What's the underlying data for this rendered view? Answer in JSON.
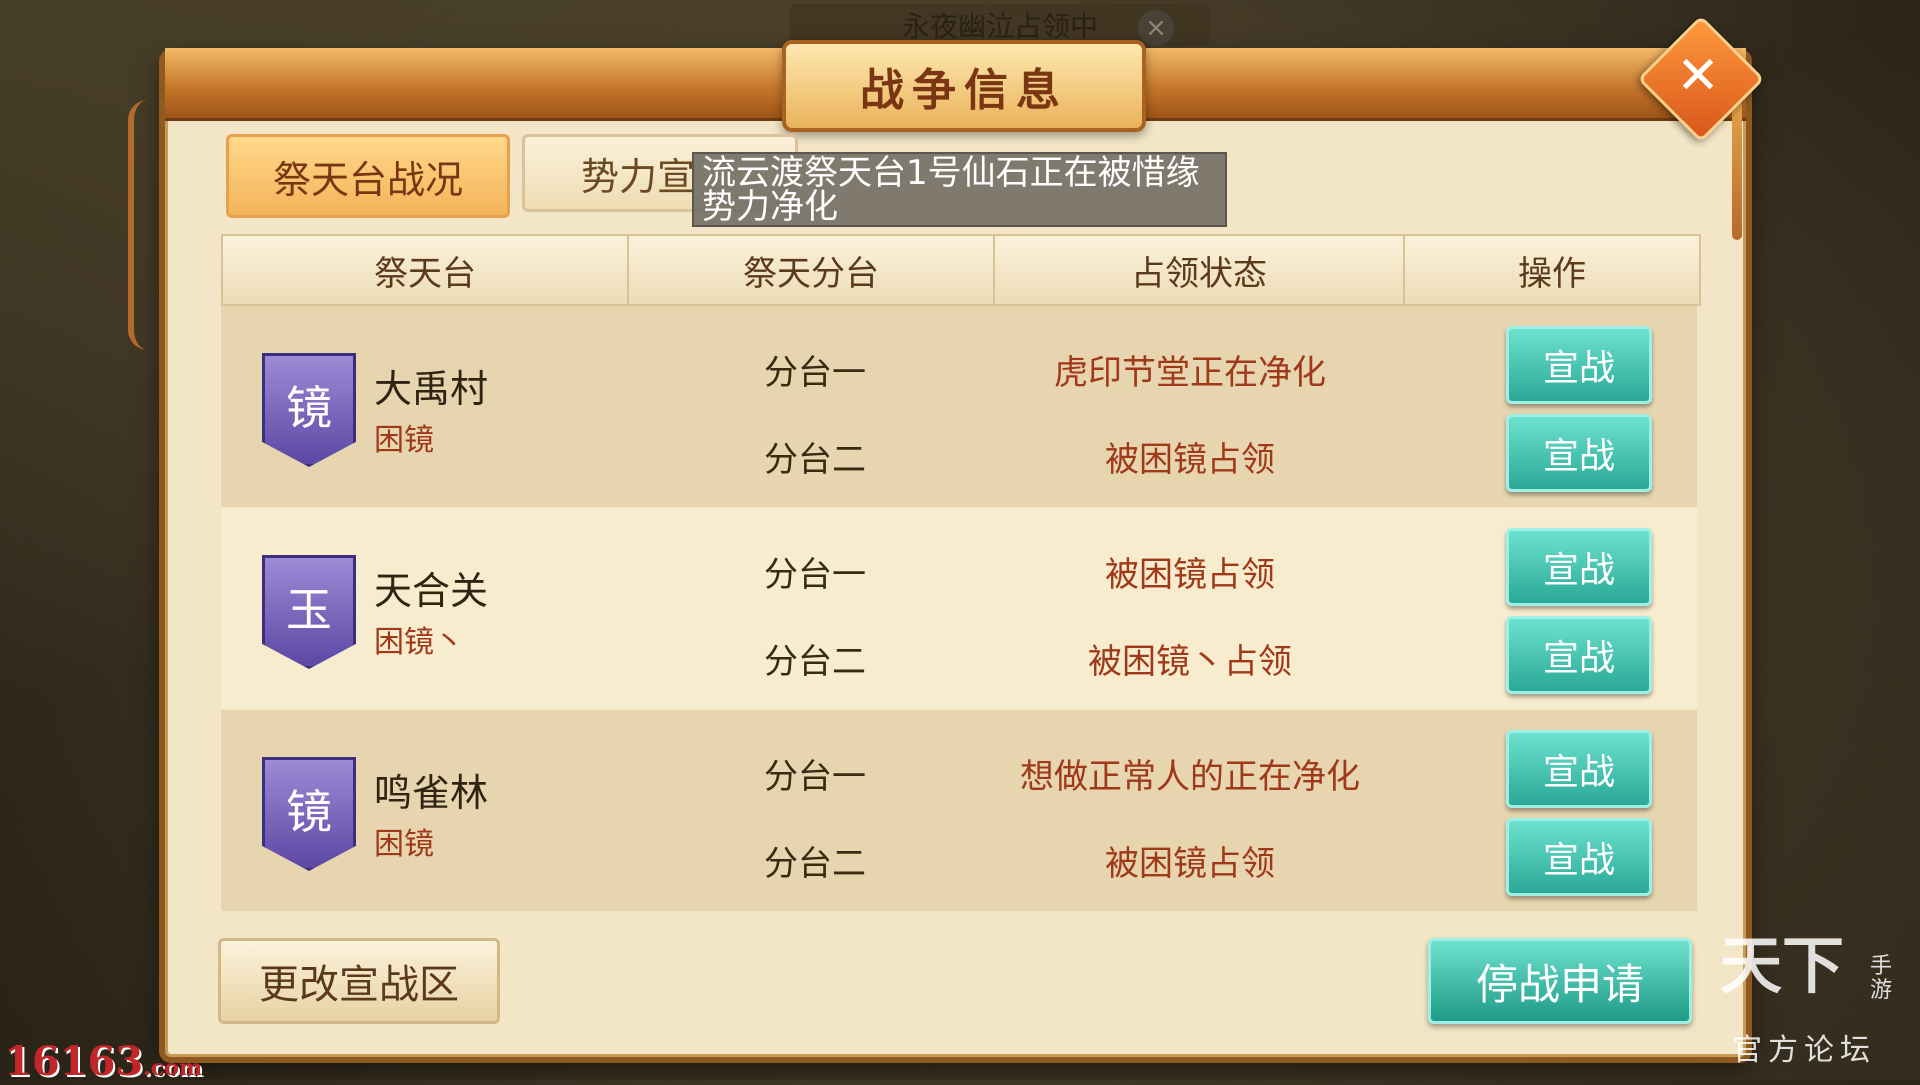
{
  "top_status": {
    "text": "永夜幽泣占领中",
    "close_glyph": "×"
  },
  "dialog": {
    "title": "战争信息",
    "close_glyph": "✕"
  },
  "tabs": [
    {
      "label": "祭天台战况",
      "active": true
    },
    {
      "label": "势力宣",
      "active": false
    }
  ],
  "tooltip": {
    "line1": "流云渡祭天台1号仙石正在被惜缘",
    "line2": "势力净化"
  },
  "table": {
    "headers": [
      "祭天台",
      "祭天分台",
      "占领状态",
      "操作"
    ],
    "rows": [
      {
        "badge": "镜",
        "name": "大禹村",
        "guild": "困镜",
        "subs": [
          {
            "sub": "分台一",
            "status": "虎印节堂正在净化",
            "action": "宣战"
          },
          {
            "sub": "分台二",
            "status": "被困镜占领",
            "action": "宣战"
          }
        ]
      },
      {
        "badge": "玉",
        "name": "天合关",
        "guild": "困镜丶",
        "subs": [
          {
            "sub": "分台一",
            "status": "被困镜占领",
            "action": "宣战"
          },
          {
            "sub": "分台二",
            "status": "被困镜丶占领",
            "action": "宣战"
          }
        ]
      },
      {
        "badge": "镜",
        "name": "鸣雀林",
        "guild": "困镜",
        "subs": [
          {
            "sub": "分台一",
            "status": "想做正常人的正在净化",
            "action": "宣战"
          },
          {
            "sub": "分台二",
            "status": "被困镜占领",
            "action": "宣战"
          }
        ]
      }
    ]
  },
  "footer": {
    "change_zone": "更改宣战区",
    "truce_request": "停战申请"
  },
  "watermarks": {
    "left_num": "16163",
    "left_suffix": ".com",
    "right_logo": "天下",
    "right_tag": "手游",
    "right_forum": "官方论坛"
  },
  "colors": {
    "accent_teal": "#2aa996",
    "status_red": "#a0381a",
    "badge_purple": "#5c48a4",
    "title_orange": "#c27428"
  }
}
